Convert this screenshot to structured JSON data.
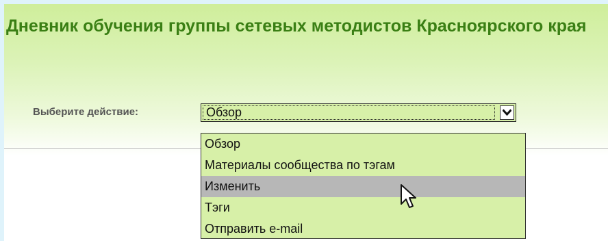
{
  "page": {
    "title": "Дневник обучения группы сетевых методистов Красноярского края"
  },
  "action": {
    "label": "Выберите действие:",
    "selected": "Обзор",
    "options": [
      {
        "label": "Обзор"
      },
      {
        "label": "Материалы сообщества по тэгам"
      },
      {
        "label": "Изменить"
      },
      {
        "label": "Тэги"
      },
      {
        "label": "Отправить e-mail"
      }
    ]
  },
  "colors": {
    "title": "#3a7f14",
    "dropdown_background": "#d7f0a8",
    "hover_option": "#b7b7b7",
    "header_gradient_top": "#cfee9b"
  },
  "icons": {
    "dropdown": "chevron-down-icon",
    "pointer": "mouse-pointer-icon"
  }
}
